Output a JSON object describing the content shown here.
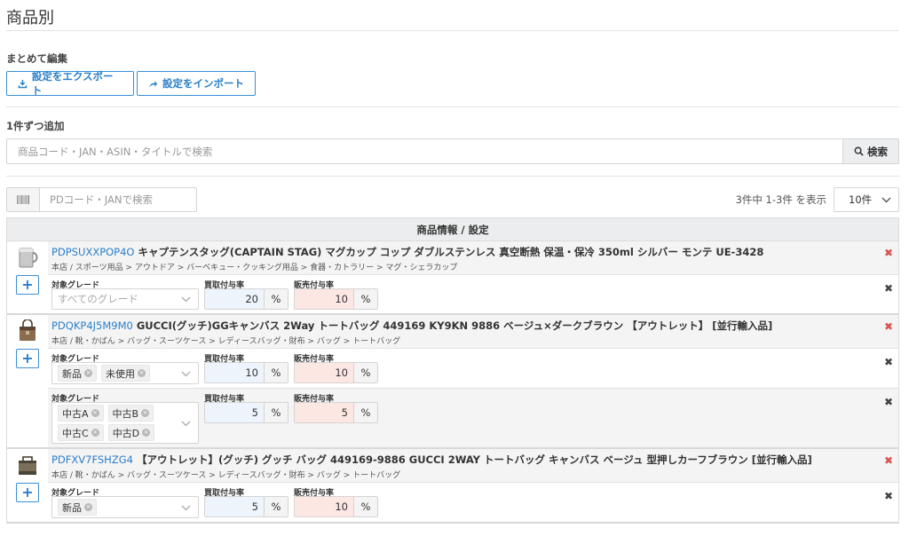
{
  "page": {
    "title": "商品別"
  },
  "bulk": {
    "label": "まとめて編集",
    "export_label": "設定をエクスポート",
    "import_label": "設定をインポート"
  },
  "add": {
    "label": "1件ずつ追加",
    "search_placeholder": "商品コード・JAN・ASIN・タイトルで検索",
    "search_button": "検索"
  },
  "list": {
    "pd_search_placeholder": "PDコード・JANで検索",
    "result_text": "3件中 1-3件 を表示",
    "per_page": "10件",
    "column_header": "商品情報 / 設定",
    "field_labels": {
      "grade": "対象グレード",
      "buy": "買取付与率",
      "sell": "販売付与率"
    },
    "percent": "%",
    "products": [
      {
        "code": "PDPSUXXPOP4O",
        "title": "キャプテンスタッグ(CAPTAIN STAG) マグカップ コップ ダブルステンレス 真空断熱 保温・保冷 350ml シルバー モンテ UE-3428",
        "category": "本店 / スポーツ用品 > アウトドア > バーベキュー・クッキング用品 > 食器・カトラリー > マグ・シェラカップ",
        "thumb": "mug-thumbnail",
        "settings": [
          {
            "grade_placeholder": "すべてのグレード",
            "grades": [],
            "buy_rate": "20",
            "sell_rate": "10"
          }
        ]
      },
      {
        "code": "PDQKP4J5M9M0",
        "title": "GUCCI(グッチ)GGキャンバス 2Way トートバッグ 449169 KY9KN 9886 ベージュ×ダークブラウン 【アウトレット】 [並行輸入品]",
        "category": "本店 / 靴・かばん > バッグ・スーツケース > レディースバッグ・財布 > バッグ > トートバッグ",
        "thumb": "brown-bag-thumbnail",
        "settings": [
          {
            "grade_placeholder": "",
            "grades": [
              "新品",
              "未使用"
            ],
            "buy_rate": "10",
            "sell_rate": "10"
          },
          {
            "grade_placeholder": "",
            "grades": [
              "中古A",
              "中古B",
              "中古C",
              "中古D"
            ],
            "buy_rate": "5",
            "sell_rate": "5"
          }
        ]
      },
      {
        "code": "PDFXV7FSHZG4",
        "title": "【アウトレット】(グッチ) グッチ バッグ 449169-9886 GUCCI 2WAY トートバッグ キャンバス ベージュ 型押しカーフブラウン [並行輸入品]",
        "category": "本店 / 靴・かばん > バッグ・スーツケース > レディースバッグ・財布 > バッグ > トートバッグ",
        "thumb": "canvas-bag-thumbnail",
        "settings": [
          {
            "grade_placeholder": "",
            "grades": [
              "新品"
            ],
            "buy_rate": "5",
            "sell_rate": "10"
          }
        ]
      }
    ]
  }
}
